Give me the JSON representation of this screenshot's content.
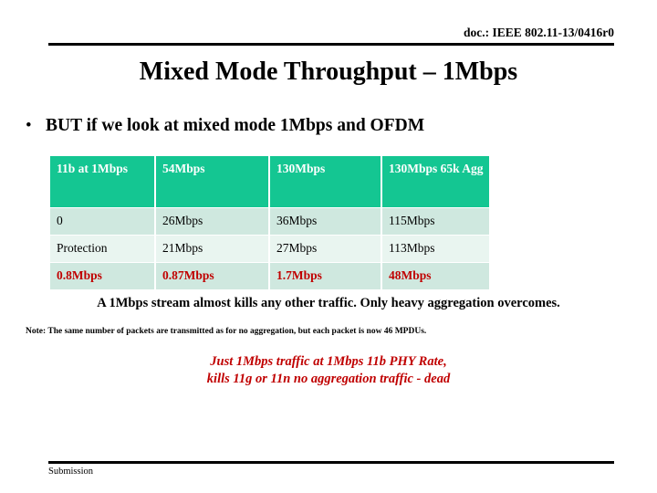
{
  "header": {
    "doc_reference": "doc.: IEEE 802.11-13/0416r0"
  },
  "title": "Mixed Mode Throughput – 1Mbps",
  "bullet": {
    "marker": "•",
    "text": "BUT if we look at mixed mode 1Mbps and OFDM"
  },
  "table": {
    "headers": [
      "11b at 1Mbps",
      "54Mbps",
      "130Mbps",
      "130Mbps 65k Agg"
    ],
    "rows": [
      [
        "0",
        "26Mbps",
        "36Mbps",
        "115Mbps"
      ],
      [
        "Protection",
        "21Mbps",
        "27Mbps",
        "113Mbps"
      ],
      [
        "0.8Mbps",
        "0.87Mbps",
        "1.7Mbps",
        "48Mbps"
      ]
    ]
  },
  "summary": "A 1Mbps stream almost kills any other traffic. Only heavy aggregation overcomes.",
  "note": "Note: The same number of packets are transmitted as for no aggregation, but each packet is now 46 MPDUs.",
  "callout": {
    "line1": "Just 1Mbps traffic at 1Mbps 11b PHY Rate,",
    "line2": "kills 11g or 11n no aggregation traffic - dead"
  },
  "footer": {
    "label": "Submission"
  },
  "colors": {
    "header_green": "#14C692",
    "row_shaded": "#CFE8DF",
    "row_light": "#E9F5F0",
    "accent_red": "#C00000",
    "text_black": "#000000",
    "page_background": "#FFFFFF"
  }
}
